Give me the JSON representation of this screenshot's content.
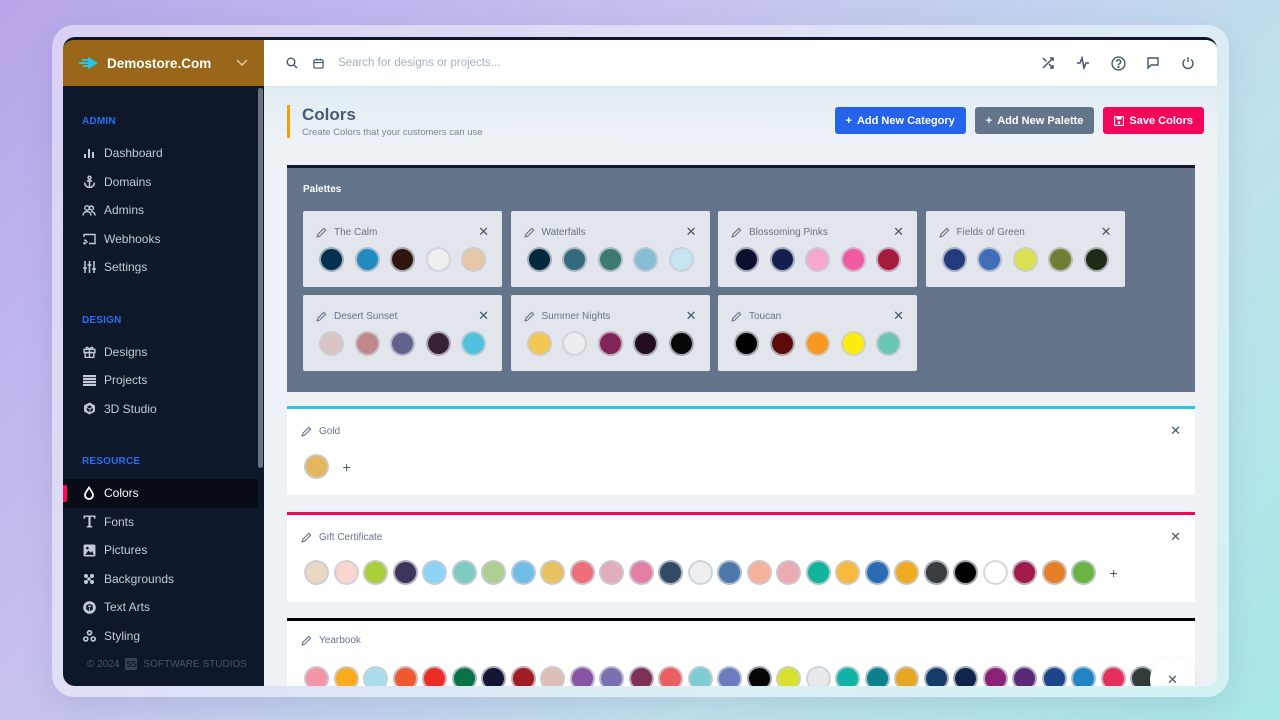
{
  "brand": {
    "name": "Demostore.Com"
  },
  "sidebar": {
    "sections": [
      {
        "title": "ADMIN",
        "items": [
          {
            "label": "Dashboard",
            "icon": "bar-chart-icon"
          },
          {
            "label": "Domains",
            "icon": "anchor-icon"
          },
          {
            "label": "Admins",
            "icon": "users-icon"
          },
          {
            "label": "Webhooks",
            "icon": "cast-icon"
          },
          {
            "label": "Settings",
            "icon": "sliders-icon"
          }
        ]
      },
      {
        "title": "DESIGN",
        "items": [
          {
            "label": "Designs",
            "icon": "gift-icon"
          },
          {
            "label": "Projects",
            "icon": "stack-icon"
          },
          {
            "label": "3D Studio",
            "icon": "cube-icon"
          }
        ]
      },
      {
        "title": "RESOURCE",
        "items": [
          {
            "label": "Colors",
            "icon": "droplet-icon",
            "active": true
          },
          {
            "label": "Fonts",
            "icon": "type-icon"
          },
          {
            "label": "Pictures",
            "icon": "image-icon"
          },
          {
            "label": "Backgrounds",
            "icon": "pattern-icon"
          },
          {
            "label": "Text Arts",
            "icon": "box-icon"
          },
          {
            "label": "Styling",
            "icon": "circles-icon"
          }
        ]
      }
    ],
    "footer": {
      "year": "© 2024",
      "company": "SOFTWARE STUDIOS"
    }
  },
  "topbar": {
    "search_placeholder": "Search for designs or projects...",
    "icons": [
      "shuffle-icon",
      "activity-icon",
      "help-icon",
      "message-icon",
      "power-icon"
    ]
  },
  "page": {
    "title": "Colors",
    "subtitle": "Create Colors that your customers can use",
    "buttons": {
      "add_category": "Add New Category",
      "add_palette": "Add New Palette",
      "save": "Save Colors"
    }
  },
  "palettes": {
    "title": "Palettes",
    "items": [
      {
        "name": "The Calm",
        "colors": [
          "#02304f",
          "#2389be",
          "#2e150d",
          "#efefef",
          "#e5c6a7"
        ]
      },
      {
        "name": "Waterfalls",
        "colors": [
          "#02293b",
          "#336a7e",
          "#3f7a6e",
          "#86bcd4",
          "#c6e4f1"
        ]
      },
      {
        "name": "Blossoming Pinks",
        "colors": [
          "#0c0f2e",
          "#141f4f",
          "#f5a8cc",
          "#ef5aa0",
          "#a51b3b"
        ]
      },
      {
        "name": "Fields of Green",
        "colors": [
          "#233a7c",
          "#436cb8",
          "#dbe053",
          "#6e7e33",
          "#1e2a16"
        ]
      },
      {
        "name": "Desert Sunset",
        "colors": [
          "#d9c5c6",
          "#c0878e",
          "#62628f",
          "#3a2236",
          "#51c1e0"
        ]
      },
      {
        "name": "Summer Nights",
        "colors": [
          "#f3c852",
          "#eeecf0",
          "#832457",
          "#230e1e",
          "#060606"
        ]
      },
      {
        "name": "Toucan",
        "colors": [
          "#000000",
          "#5d0a0c",
          "#f7991e",
          "#fcec10",
          "#6cc6b6"
        ]
      }
    ]
  },
  "categories": [
    {
      "name": "Gold",
      "accent": "#22c8e5",
      "colors": [
        "#e3b660"
      ]
    },
    {
      "name": "Gift Certificate",
      "accent": "#f2075a",
      "colors": [
        "#e8d8c4",
        "#f9d5d0",
        "#abce3b",
        "#3f3359",
        "#8dd3f2",
        "#7fcbc0",
        "#aecf91",
        "#70bde8",
        "#e8c161",
        "#ee6f7b",
        "#e1adba",
        "#e37ea6",
        "#334a65",
        "#eceeef",
        "#4e78a8",
        "#f5b19b",
        "#ecaab1",
        "#12b499",
        "#f8b73d",
        "#2a6cb3",
        "#eeaa20",
        "#393c40",
        "#000000",
        "#ffffff",
        "#a11a4b",
        "#e77e28",
        "#6ab444"
      ]
    },
    {
      "name": "Yearbook",
      "accent": "#000000",
      "colors": [
        "#f395a9",
        "#f9ab1e",
        "#abdcea",
        "#ee5a2f",
        "#ec2d26",
        "#0a7249",
        "#141530",
        "#a01d22",
        "#ddbeb5",
        "#8955a3",
        "#7b6fb1",
        "#7e3157",
        "#eb5e62",
        "#7ecdd1",
        "#6b7cbf",
        "#050505",
        "#d8e12f",
        "#e8e9ea",
        "#12b3a7",
        "#0a818d",
        "#e6a824",
        "#173c69",
        "#0d2549",
        "#8a2377",
        "#5a2a75",
        "#1c4689",
        "#1f85c7",
        "#e5305e",
        "#333c3b"
      ]
    }
  ]
}
